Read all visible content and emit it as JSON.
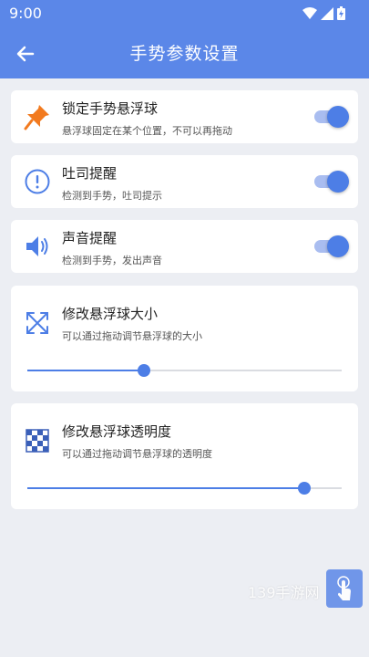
{
  "status": {
    "time": "9:00"
  },
  "header": {
    "title": "手势参数设置",
    "back_icon": "arrow-left-icon"
  },
  "settings": [
    {
      "title": "锁定手势悬浮球",
      "subtitle": "悬浮球固定在某个位置，不可以再拖动",
      "icon": "pushpin-icon",
      "enabled": true
    },
    {
      "title": "吐司提醒",
      "subtitle": "检测到手势，吐司提示",
      "icon": "exclamation-circle-icon",
      "enabled": true
    },
    {
      "title": "声音提醒",
      "subtitle": "检测到手势，发出声音",
      "icon": "speaker-icon",
      "enabled": true
    }
  ],
  "size_slider": {
    "title": "修改悬浮球大小",
    "subtitle": "可以通过拖动调节悬浮球的大小",
    "icon": "expand-arrows-icon",
    "value_fraction": 0.37
  },
  "opacity_slider": {
    "title": "修改悬浮球透明度",
    "subtitle": "可以通过拖动调节悬浮球的透明度",
    "icon": "checkerboard-icon",
    "value_fraction": 0.88
  },
  "watermark": "139手游网",
  "colors": {
    "primary": "#5b87e8",
    "accent": "#4d7ee6",
    "pin": "#f27a1f",
    "background": "#eceef3"
  }
}
